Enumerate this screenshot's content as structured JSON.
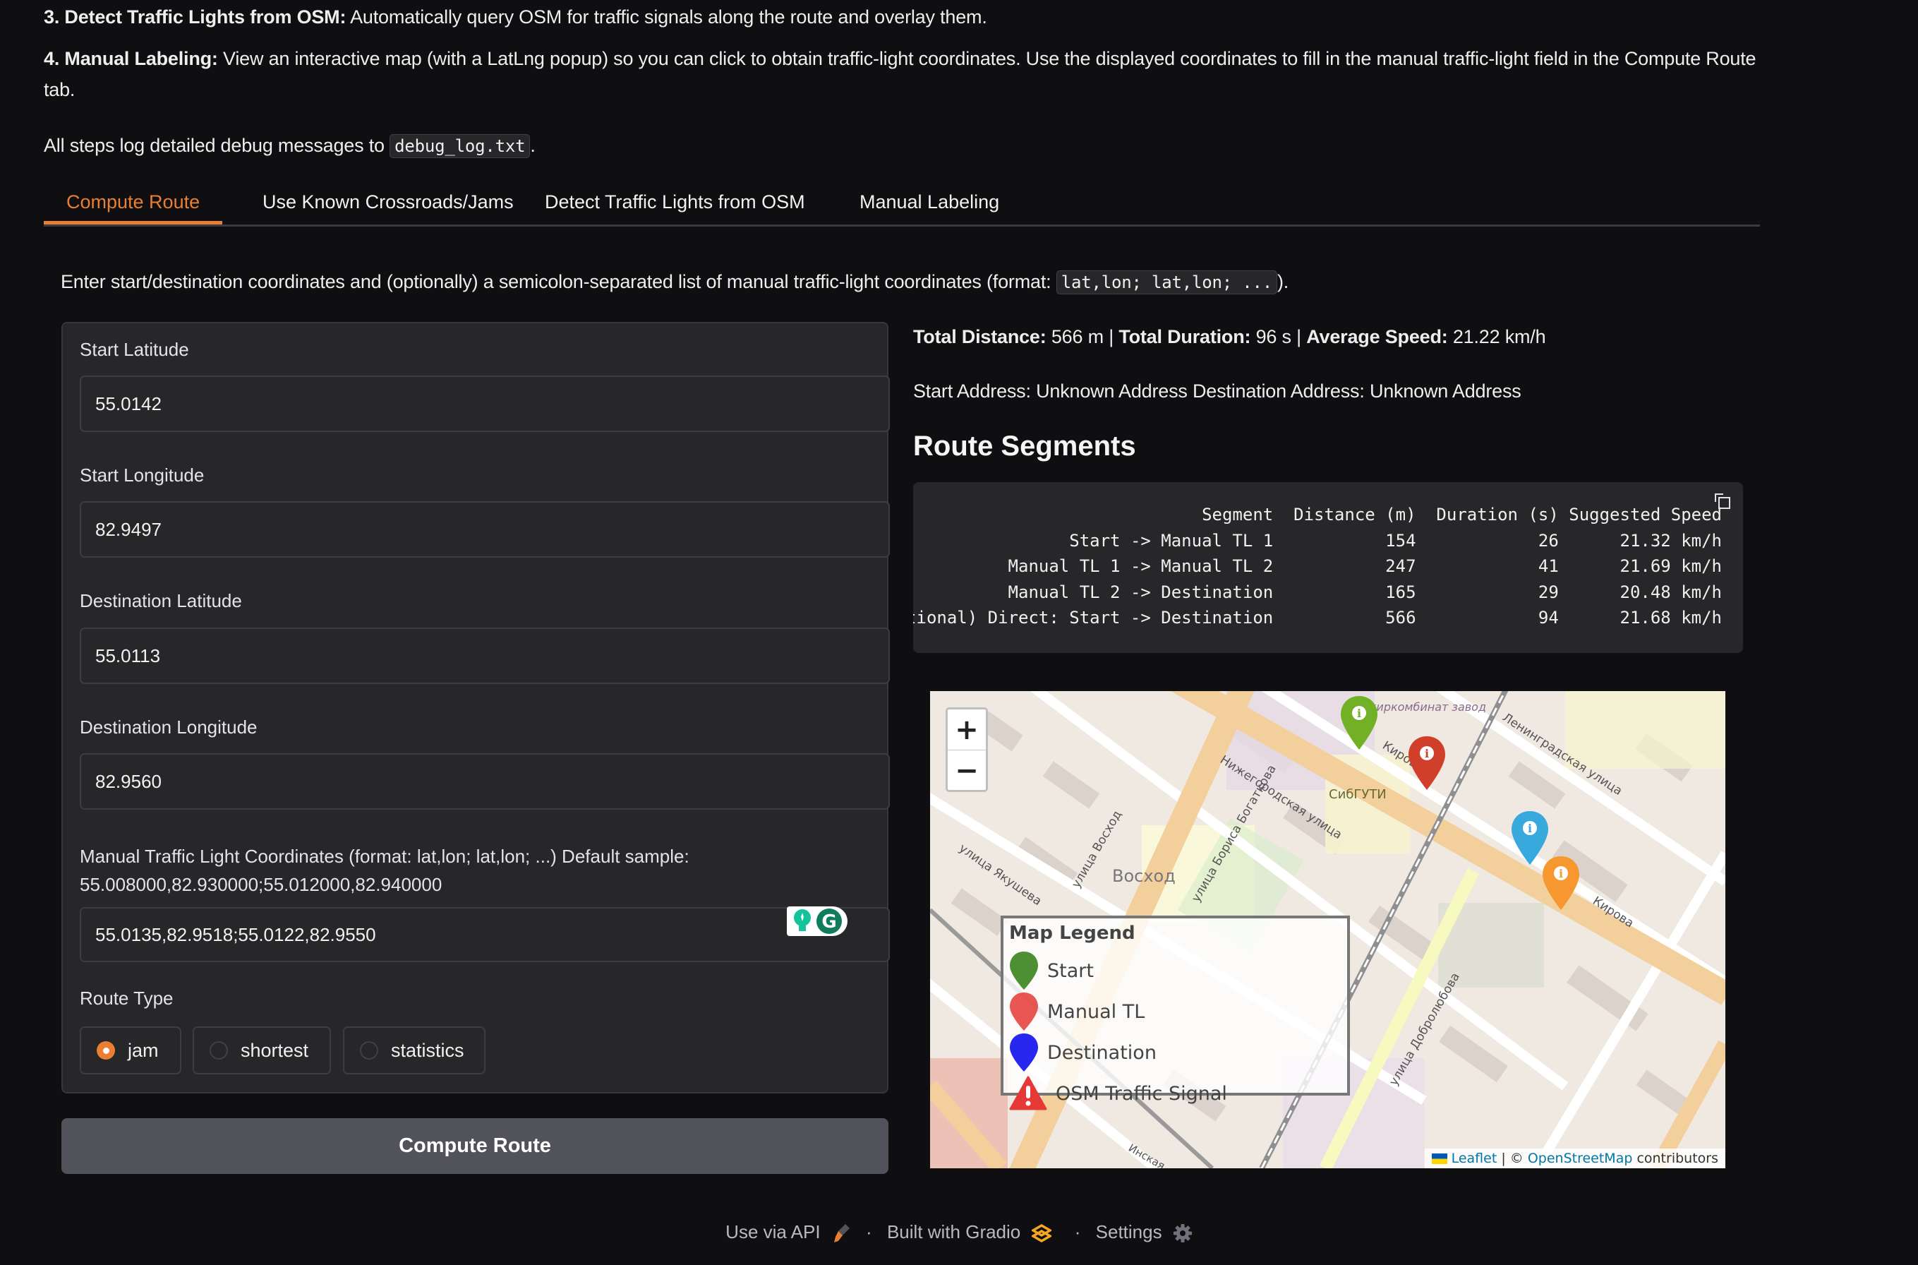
{
  "intro": {
    "step3_bold": "3. Detect Traffic Lights from OSM:",
    "step3_text": " Automatically query OSM for traffic signals along the route and overlay them.",
    "step4_bold": "4. Manual Labeling:",
    "step4_text": " View an interactive map (with a LatLng popup) so you can click to obtain traffic-light coordinates. Use the displayed coordinates to fill in the manual traffic-light field in the Compute Route",
    "step4_text_cont": "tab.",
    "log_text": "All steps log detailed debug messages to ",
    "log_file": "debug_log.txt",
    "log_end": "."
  },
  "tabs": [
    {
      "label": "Compute Route",
      "active": true
    },
    {
      "label": "Use Known Crossroads/Jams",
      "active": false
    },
    {
      "label": "Detect Traffic Lights from OSM",
      "active": false
    },
    {
      "label": "Manual Labeling",
      "active": false
    }
  ],
  "instructions": {
    "text": "Enter start/destination coordinates and (optionally) a semicolon-separated list of manual traffic-light coordinates (format: ",
    "code": "lat,lon; lat,lon; ...",
    "end": ")."
  },
  "form": {
    "start_lat": {
      "label": "Start Latitude",
      "value": "55.0142"
    },
    "start_lon": {
      "label": "Start Longitude",
      "value": "82.9497"
    },
    "dest_lat": {
      "label": "Destination Latitude",
      "value": "55.0113"
    },
    "dest_lon": {
      "label": "Destination Longitude",
      "value": "82.9560"
    },
    "manual_tl": {
      "label_line1": "Manual Traffic Light Coordinates (format: lat,lon; lat,lon; ...) Default sample:",
      "label_line2": "55.008000,82.930000;55.012000,82.940000",
      "value": "55.0135,82.9518;55.0122,82.9550"
    },
    "route_type": {
      "label": "Route Type",
      "options": [
        "jam",
        "shortest",
        "statistics"
      ],
      "selected": "jam"
    },
    "compute_button": "Compute Route"
  },
  "results": {
    "summary": {
      "distance_label": "Total Distance:",
      "distance_value": " 566 m | ",
      "duration_label": "Total Duration:",
      "duration_value": " 96 s | ",
      "speed_label": "Average Speed:",
      "speed_value": " 21.22 km/h"
    },
    "addresses": "Start Address: Unknown Address Destination Address: Unknown Address",
    "segments_heading": "Route Segments",
    "segments_table": {
      "columns": [
        "Segment",
        "Distance (m)",
        "Duration (s)",
        "Suggested Speed"
      ],
      "rows": [
        [
          "Start -> Manual TL 1",
          "154",
          "26",
          "21.32 km/h"
        ],
        [
          "Manual TL 1 -> Manual TL 2",
          "247",
          "41",
          "21.69 km/h"
        ],
        [
          "Manual TL 2 -> Destination",
          "165",
          "29",
          "20.48 km/h"
        ],
        [
          "(Optional) Direct: Start -> Destination",
          "566",
          "94",
          "21.68 km/h"
        ]
      ],
      "text": "                               Segment  Distance (m)  Duration (s) Suggested Speed\n                  Start -> Manual TL 1           154            26      21.32 km/h\n            Manual TL 1 -> Manual TL 2           247            41      21.69 km/h\n            Manual TL 2 -> Destination           165            29      20.48 km/h\n(Optional) Direct: Start -> Destination           566            94      21.68 km/h"
    }
  },
  "map": {
    "zoom_in": "+",
    "zoom_out": "−",
    "labels": [
      "улица Восход",
      "Восход",
      "Нижегородская улица",
      "улица Бориса Богаткова",
      "СибГУТИ",
      "улица Кирова",
      "Ленинградская улица",
      "улица Якушева",
      "улица Добролюбова",
      "Кирова",
      "Новосибирский жиркомбинат / маргариновый завод",
      "Инская"
    ],
    "markers": [
      {
        "type": "start",
        "color": "#72b026"
      },
      {
        "type": "manual-tl-1",
        "color": "#d03f2a"
      },
      {
        "type": "destination",
        "color": "#38a9dc"
      },
      {
        "type": "manual-tl-2",
        "color": "#f69730"
      }
    ],
    "legend": {
      "title": "Map Legend",
      "items": [
        {
          "label": "Start",
          "color": "#2e7d10"
        },
        {
          "label": "Manual TL",
          "color": "#e53935"
        },
        {
          "label": "Destination",
          "color": "#1010ee"
        },
        {
          "label": "OSM Traffic Signal",
          "color": "#e53935"
        }
      ]
    },
    "attribution": {
      "leaflet": "Leaflet",
      "sep": " | © ",
      "osm": "OpenStreetMap",
      "suffix": " contributors"
    }
  },
  "footer": {
    "api": "Use via API",
    "built": "Built with Gradio",
    "settings": "Settings"
  },
  "colors": {
    "accent": "#ea7e32",
    "background": "#0f0f11",
    "panel": "#27272a"
  }
}
